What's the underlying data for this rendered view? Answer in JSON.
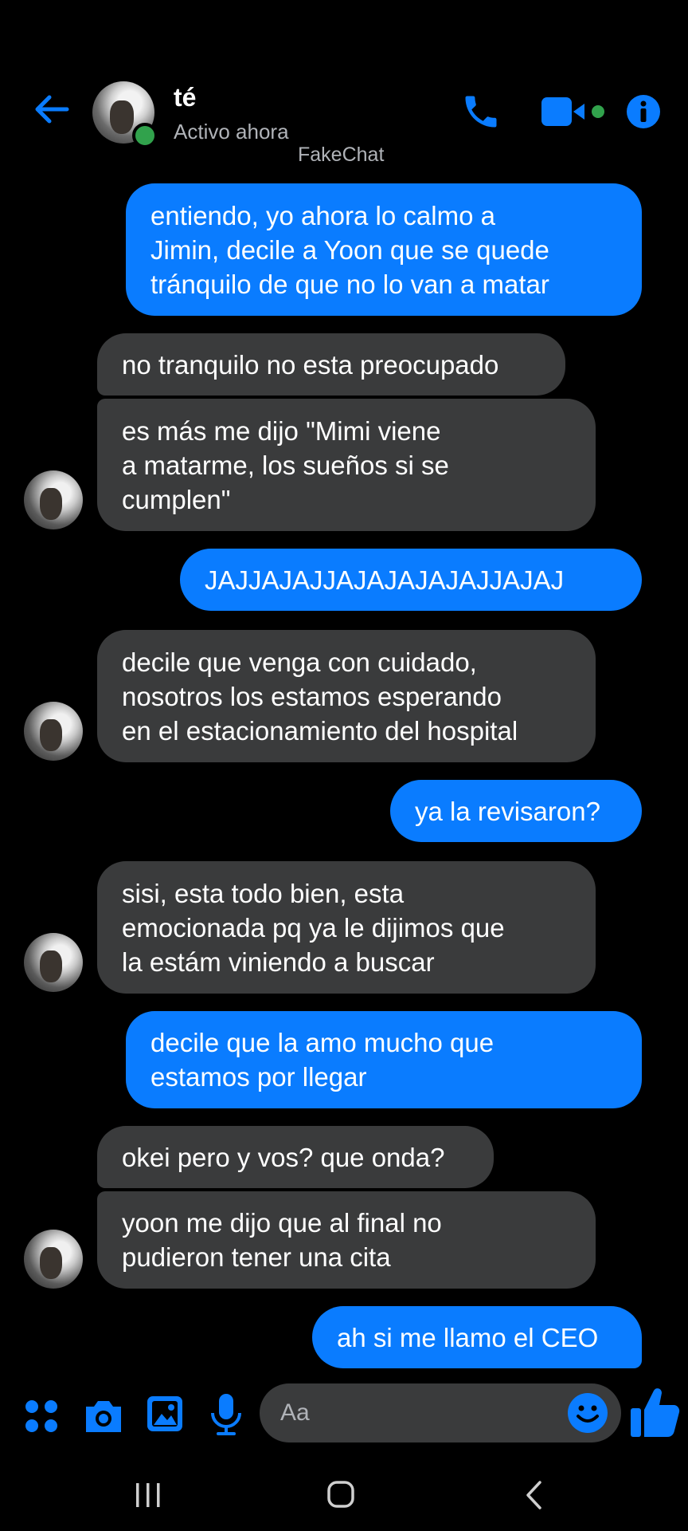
{
  "header": {
    "contact_name": "té",
    "status": "Activo ahora",
    "watermark": "FakeChat",
    "accent": "#0a7cff"
  },
  "messages": [
    {
      "side": "out",
      "text": "entiendo, yo ahora lo calmo a\nJimin, decile a Yoon que se quede\ntránquilo de que no lo van a matar"
    },
    {
      "side": "in",
      "text": "no tranquilo no esta preocupado"
    },
    {
      "side": "in",
      "text": "es más me dijo \"Mimi viene\na matarme, los sueños si se\ncumplen\""
    },
    {
      "side": "out",
      "text": "JAJJAJAJJAJAJAJAJAJJAJAJ"
    },
    {
      "side": "in",
      "text": "decile que venga con cuidado,\nnosotros los estamos esperando\nen el estacionamiento del hospital"
    },
    {
      "side": "out",
      "text": "ya la revisaron?"
    },
    {
      "side": "in",
      "text": "sisi, esta todo bien, esta\nemocionada pq ya le dijimos que\nla estám viniendo a buscar"
    },
    {
      "side": "out",
      "text": "decile que la amo mucho que\nestamos por llegar"
    },
    {
      "side": "in",
      "text": "okei pero y vos? que onda?"
    },
    {
      "side": "in",
      "text": "yoon me dijo que al final no\npudieron tener una cita"
    },
    {
      "side": "out",
      "text": "ah si me llamo el CEO"
    }
  ],
  "composer": {
    "placeholder": "Aa",
    "icons": [
      "apps-icon",
      "camera-icon",
      "gallery-icon",
      "microphone-icon",
      "emoji-icon",
      "thumbs-up-icon"
    ]
  },
  "navbar": {
    "icons": [
      "recent-apps-icon",
      "home-icon",
      "back-nav-icon"
    ]
  }
}
